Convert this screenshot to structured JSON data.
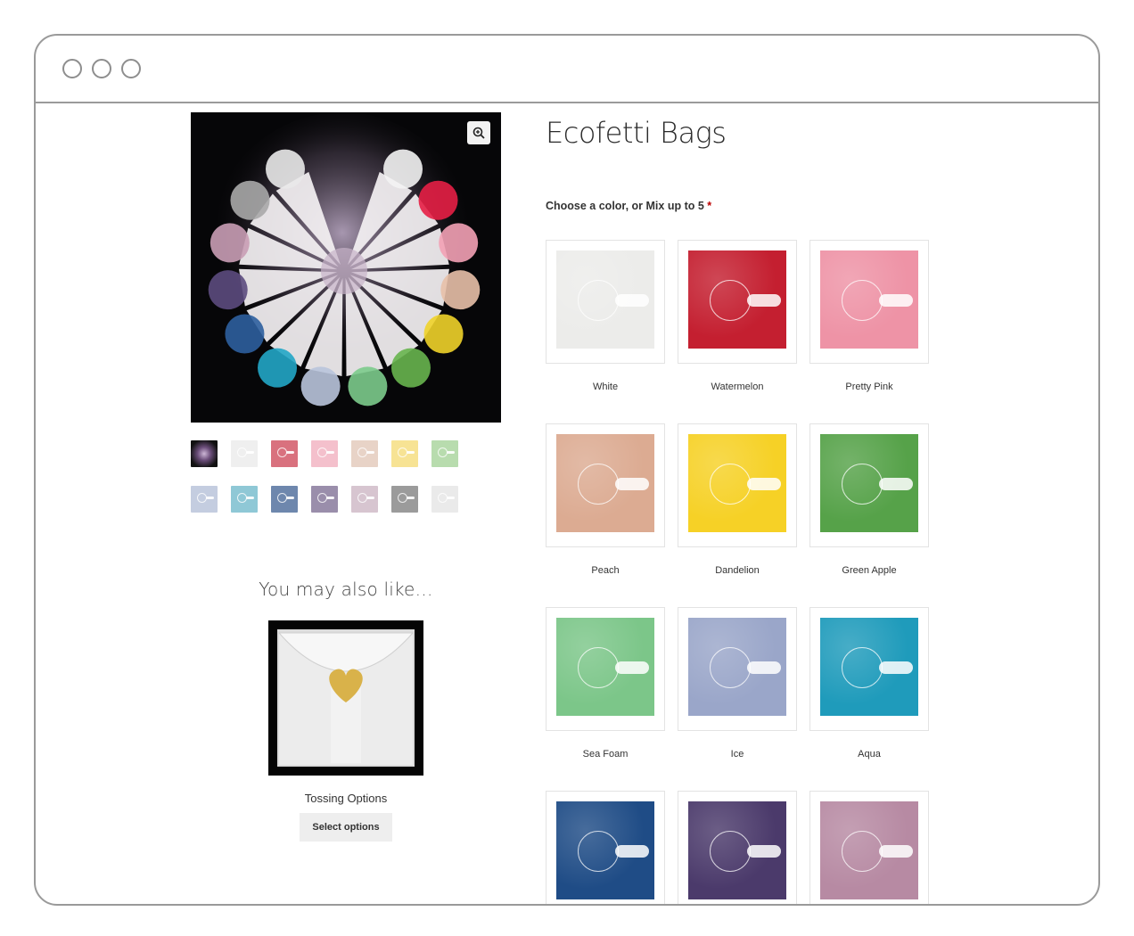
{
  "product": {
    "title": "Ecofetti Bags",
    "choose_label": "Choose a color, or Mix up to 5",
    "required_mark": "*"
  },
  "gallery": {
    "zoom_icon": "zoom-in-icon",
    "thumbnails": [
      {
        "name": "mixed",
        "color": "#1a1020"
      },
      {
        "name": "white",
        "color": "#efefef"
      },
      {
        "name": "watermelon",
        "color": "#d9717e"
      },
      {
        "name": "pretty-pink",
        "color": "#f4c0cc"
      },
      {
        "name": "peach",
        "color": "#e8d3c7"
      },
      {
        "name": "dandelion",
        "color": "#f7e394"
      },
      {
        "name": "green-apple",
        "color": "#b8dcae"
      },
      {
        "name": "ice",
        "color": "#c4cde0"
      },
      {
        "name": "aqua",
        "color": "#8fc8d6"
      },
      {
        "name": "navy",
        "color": "#6e87ad"
      },
      {
        "name": "purple",
        "color": "#9a8eab"
      },
      {
        "name": "mauve",
        "color": "#d7c5d0"
      },
      {
        "name": "gray",
        "color": "#9b9b9b"
      },
      {
        "name": "clear",
        "color": "#eaeaea"
      }
    ]
  },
  "related": {
    "heading": "You may also like…",
    "title": "Tossing Options",
    "button_label": "Select options"
  },
  "swatches": [
    {
      "label": "White",
      "color": "#ececea"
    },
    {
      "label": "Watermelon",
      "color": "#c41f30"
    },
    {
      "label": "Pretty Pink",
      "color": "#ee93a6"
    },
    {
      "label": "Peach",
      "color": "#dcab92"
    },
    {
      "label": "Dandelion",
      "color": "#f6d126"
    },
    {
      "label": "Green Apple",
      "color": "#56a249"
    },
    {
      "label": "Sea Foam",
      "color": "#7cc689"
    },
    {
      "label": "Ice",
      "color": "#9aa6c9"
    },
    {
      "label": "Aqua",
      "color": "#1f9bbb"
    },
    {
      "label": "",
      "color": "#1f4c86"
    },
    {
      "label": "",
      "color": "#4b3a6b"
    },
    {
      "label": "",
      "color": "#b78aa3"
    }
  ]
}
